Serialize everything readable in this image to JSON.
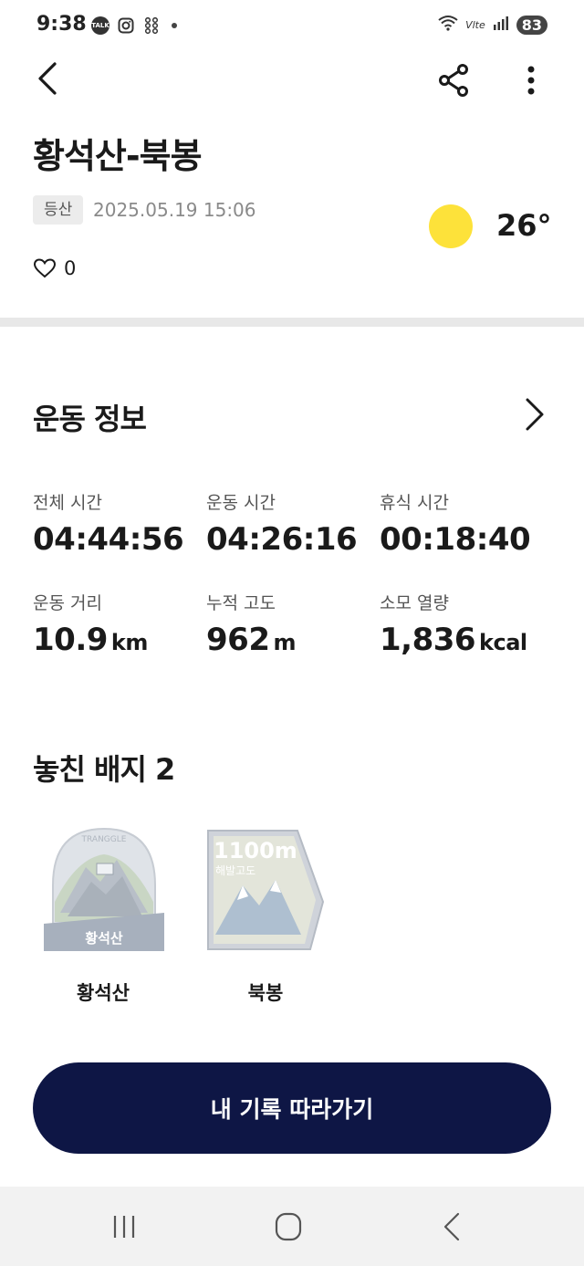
{
  "status_bar": {
    "time": "9:38",
    "left_icons": [
      "kakao-talk-icon",
      "instagram-icon",
      "app-grid-icon",
      "notification-dot-icon"
    ],
    "volte_label": "Vlte",
    "battery": "83"
  },
  "header": {
    "title": "황석산-북봉",
    "tag": "등산",
    "datetime": "2025.05.19 15:06",
    "weather_icon": "sun-icon",
    "temperature": "26°",
    "likes": "0"
  },
  "exercise": {
    "section_title": "운동 정보",
    "stats": [
      {
        "label": "전체 시간",
        "value": "04:44:56",
        "unit": ""
      },
      {
        "label": "운동 시간",
        "value": "04:26:16",
        "unit": ""
      },
      {
        "label": "휴식 시간",
        "value": "00:18:40",
        "unit": ""
      },
      {
        "label": "운동 거리",
        "value": "10.9",
        "unit": "km"
      },
      {
        "label": "누적 고도",
        "value": "962",
        "unit": "m"
      },
      {
        "label": "소모 열량",
        "value": "1,836",
        "unit": "kcal"
      }
    ]
  },
  "badges": {
    "section_title": "놓친 배지 2",
    "items": [
      {
        "name": "황석산",
        "badge_text": "황석산",
        "arc_text": "TRANGGLE"
      },
      {
        "name": "북봉",
        "badge_text": "1100m",
        "sub_text": "해발고도"
      }
    ]
  },
  "cta": {
    "label": "내 기록 따라가기"
  },
  "colors": {
    "accent_navy": "#0e1645",
    "sun": "#fde23a",
    "badge_gray": "#cfd3da"
  },
  "nav": [
    "recents-icon",
    "home-icon",
    "back-icon"
  ]
}
